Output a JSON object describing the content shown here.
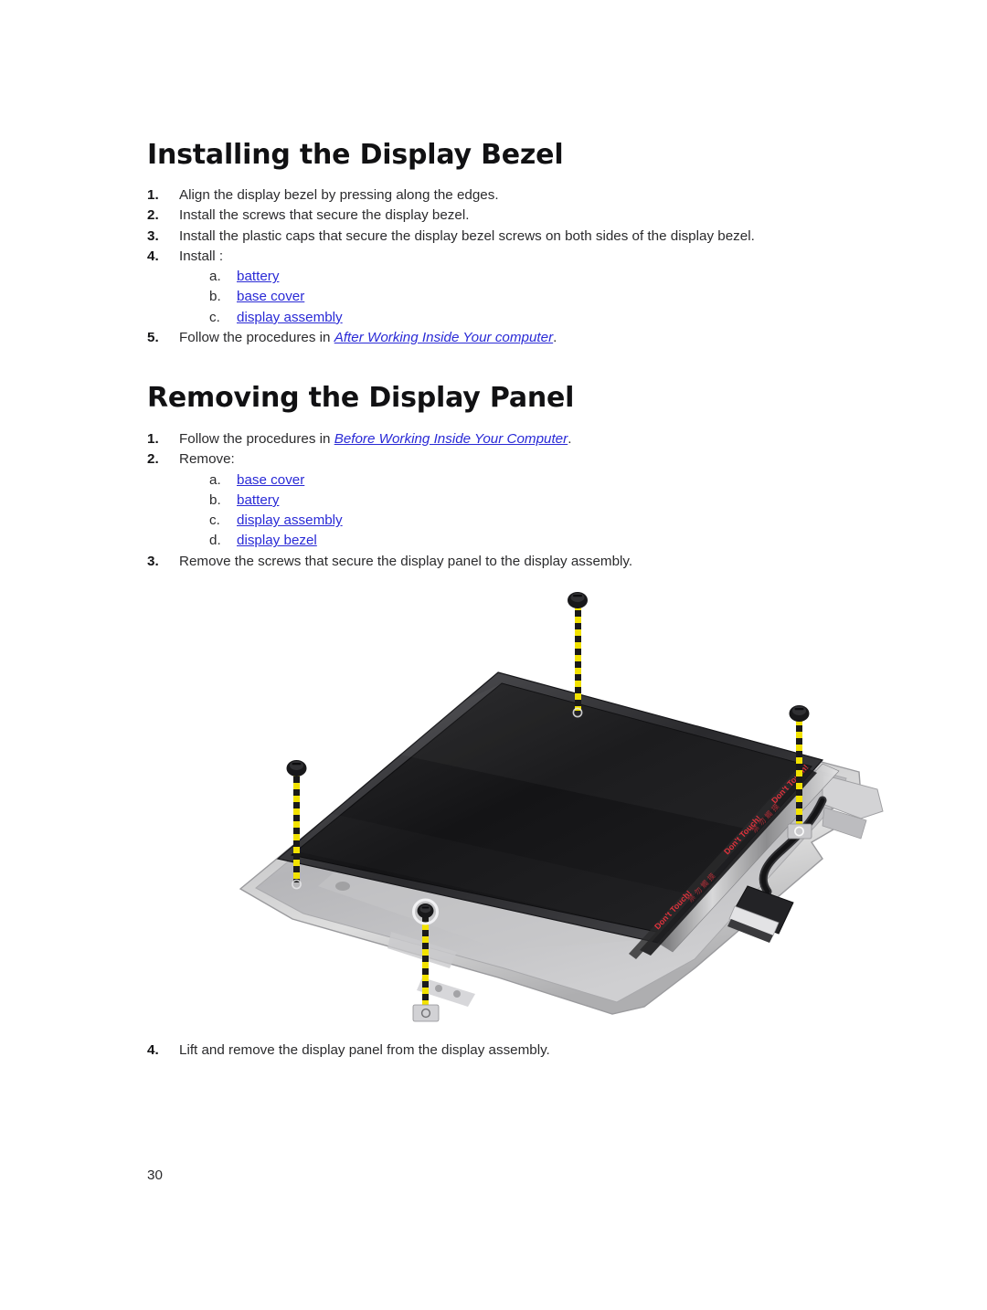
{
  "document": {
    "page_number": "30"
  },
  "sections": [
    {
      "id": "install-bezel",
      "title": "Installing the Display Bezel",
      "steps": [
        {
          "num": "1.",
          "text": "Align the display bezel by pressing along the edges."
        },
        {
          "num": "2.",
          "text": "Install the screws that secure the display bezel."
        },
        {
          "num": "3.",
          "text": "Install the plastic caps that secure the display bezel screws on both sides of the display bezel."
        },
        {
          "num": "4.",
          "text": "Install :",
          "subs": [
            {
              "letter": "a.",
              "link": "battery"
            },
            {
              "letter": "b.",
              "link": "base cover"
            },
            {
              "letter": "c.",
              "link": "display assembly"
            }
          ]
        },
        {
          "num": "5.",
          "prefix": "Follow the procedures in ",
          "link": "After Working Inside Your computer",
          "suffix": "."
        }
      ]
    },
    {
      "id": "remove-panel",
      "title": "Removing the Display Panel",
      "steps": [
        {
          "num": "1.",
          "prefix": "Follow the procedures in ",
          "link": "Before Working Inside Your Computer",
          "suffix": "."
        },
        {
          "num": "2.",
          "text": "Remove:",
          "subs": [
            {
              "letter": "a.",
              "link": "base cover"
            },
            {
              "letter": "b.",
              "link": "battery"
            },
            {
              "letter": "c.",
              "link": "display assembly"
            },
            {
              "letter": "d.",
              "link": "display bezel"
            }
          ]
        },
        {
          "num": "3.",
          "text": "Remove the screws that secure the display panel to the display assembly."
        }
      ],
      "steps_after_figure": [
        {
          "num": "4.",
          "text": "Lift and remove the display panel from the display assembly."
        }
      ]
    }
  ],
  "figure": {
    "caption_alt": "Display panel resting in display assembly with four callout screws",
    "tape_label": "Don't Touch!",
    "callouts": [
      {
        "id": "screw-top",
        "type": "screw-head"
      },
      {
        "id": "screw-left",
        "type": "screw-head"
      },
      {
        "id": "screw-right",
        "type": "screw-head"
      },
      {
        "id": "screw-bottom",
        "type": "screw-ring"
      }
    ]
  },
  "colors": {
    "link": "#2a2ad6",
    "body_text": "#2b2b2d",
    "heading": "#111113",
    "callout_yellow": "#f2e200",
    "callout_black": "#1a1a1a",
    "tape_red": "#e0323c",
    "background": "#ffffff"
  }
}
